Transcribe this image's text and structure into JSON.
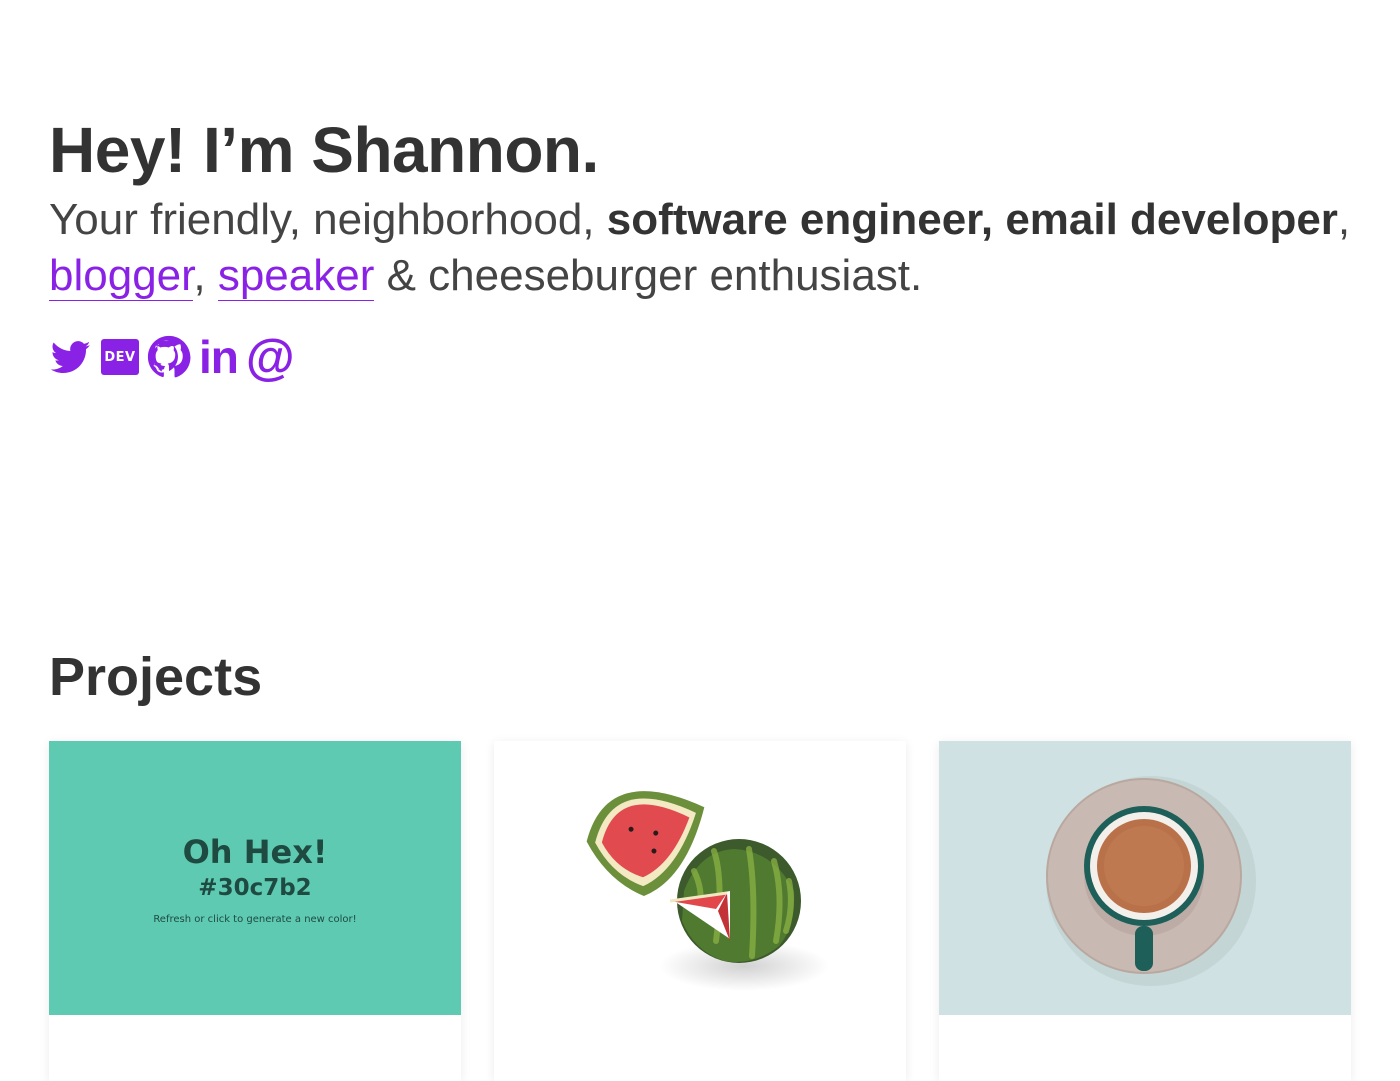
{
  "hero": {
    "title": "Hey! I’m Shannon.",
    "tagline": {
      "part1": "Your friendly, neighborhood, ",
      "bold": "software engineer, email developer",
      "part2": ",",
      "link1": "blogger",
      "sep": ", ",
      "link2": "speaker",
      "part3": " & cheeseburger enthusiast."
    }
  },
  "socials": [
    {
      "icon": "twitter-icon"
    },
    {
      "icon": "dev-icon",
      "text": "DEV"
    },
    {
      "icon": "github-icon"
    },
    {
      "icon": "linkedin-icon",
      "text": "in"
    },
    {
      "icon": "email-icon",
      "text": "@"
    }
  ],
  "projects": {
    "heading": "Projects",
    "cards": [
      {
        "image": "oh-hex-preview",
        "title": "Oh Hex!",
        "code": "#30c7b2",
        "note": "Refresh or click to generate a new color!"
      },
      {
        "image": "watermelon-photo"
      },
      {
        "image": "coffee-cup-photo"
      }
    ]
  },
  "colors": {
    "accent": "#8a22e6",
    "text": "#333333",
    "hex_bg": "#5ecab2",
    "coffee_bg": "#cfe1e2"
  }
}
